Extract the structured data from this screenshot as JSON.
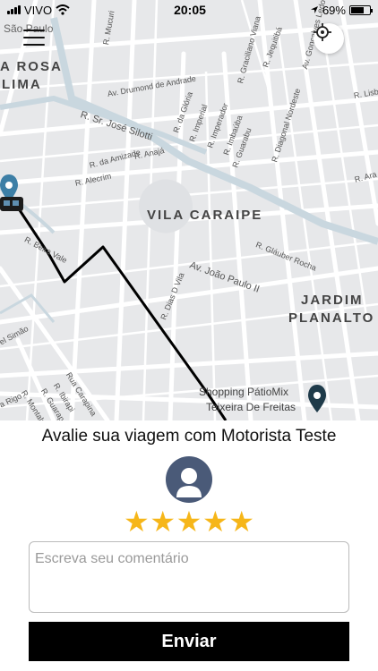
{
  "status_bar": {
    "carrier": "VIVO",
    "time": "20:05",
    "battery": "69%",
    "battery_level": 0.69
  },
  "map": {
    "labels": {
      "city": "São Paulo",
      "rosa": "A ROSA",
      "lima": "LIMA",
      "vila_caraipe": "VILA CARAIPE",
      "jardim": "JARDIM",
      "planalto": "PLANALTO",
      "shopping_line1": "Shopping PátioMix",
      "shopping_line2": "Teixeira De Freitas",
      "drumond": "Av. Drumond de Andrade",
      "silotti": "R. Sr. José Silotti",
      "joao_paulo": "Av. João Paulo II",
      "gloria": "R. da Glória",
      "imperial": "R. Imperial",
      "imperador": "R. Imperador",
      "imbauba": "R. Imbaúba",
      "guarabu": "R. Guarabu",
      "graciliano": "R. Graciliano Viana",
      "diagonal": "R. Diagonal Nordeste",
      "jequitiba": "R. Jequitibá",
      "goncalves": "Av. Gonçalves Ledo",
      "mucuri": "R. Mucuri",
      "anaja": "R. Anajá",
      "amizade": "R. da Amizade",
      "alecrim": "R. Alecrim",
      "glauber": "R. Gláuber Rocha",
      "dias_d_vila": "R. Dias D Vila",
      "beira_vale": "R. Beira Vale",
      "carapina": "Rua Carapina",
      "ibirapi": "R. Ibirapi",
      "guarapari": "R. Guarapari",
      "montalvo": "R. Montalvo",
      "simao": "el Simão",
      "rigo": "a Rigo",
      "lisb": "R. Lisb",
      "ara": "R. Ara"
    }
  },
  "rating": {
    "title": "Avalie sua viagem com Motorista Teste",
    "stars": [
      "★",
      "★",
      "★",
      "★",
      "★"
    ],
    "comment_placeholder": "Escreva seu comentário",
    "comment_value": "",
    "submit_label": "Enviar"
  }
}
